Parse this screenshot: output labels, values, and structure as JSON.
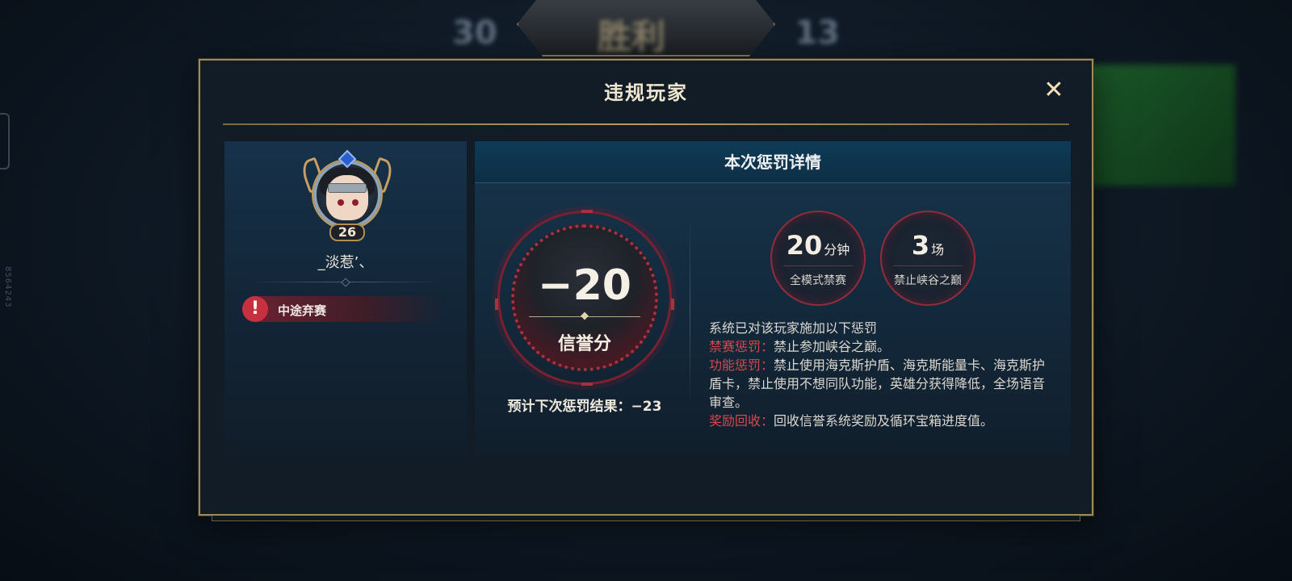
{
  "background": {
    "score_left": "30",
    "score_right": "13",
    "result_banner": "胜利",
    "side_text": "8564243"
  },
  "modal": {
    "title": "违规玩家",
    "close_label": "✕"
  },
  "player": {
    "level": "26",
    "name": "_淡惹’、",
    "violation_icon": "!",
    "violation": "中途弃赛"
  },
  "detail": {
    "header": "本次惩罚详情",
    "score_value": "−20",
    "score_label": "信誉分",
    "next_result": "预计下次惩罚结果：−23",
    "stats": [
      {
        "number": "20",
        "unit": "分钟",
        "label": "全模式禁赛"
      },
      {
        "number": "3",
        "unit": "场",
        "label": "禁止峡谷之巅"
      }
    ],
    "intro": "系统已对该玩家施加以下惩罚",
    "penalties": [
      {
        "key": "禁赛惩罚：",
        "text": "禁止参加峡谷之巅。"
      },
      {
        "key": "功能惩罚：",
        "text": "禁止使用海克斯护盾、海克斯能量卡、海克斯护盾卡，禁止使用不想同队功能，英雄分获得降低，全场语音审查。"
      },
      {
        "key": "奖励回收：",
        "text": "回收信誉系统奖励及循环宝箱进度值。"
      }
    ]
  },
  "colors": {
    "accent_gold": "#a08b55",
    "penalty_red": "#d5484f",
    "panel_blue": "#0f3b57"
  }
}
